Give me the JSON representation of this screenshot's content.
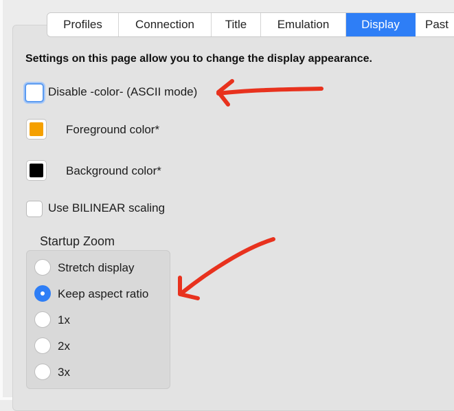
{
  "tabs": [
    {
      "label": "Profiles",
      "active": false
    },
    {
      "label": "Connection",
      "active": false
    },
    {
      "label": "Title",
      "active": false
    },
    {
      "label": "Emulation",
      "active": false
    },
    {
      "label": "Display",
      "active": true
    },
    {
      "label": "Past",
      "active": false
    }
  ],
  "display": {
    "description": "Settings on this page allow you to change the display appearance.",
    "disable_color": {
      "label": "Disable -color- (ASCII mode)",
      "checked": false
    },
    "foreground": {
      "label": "Foreground color*",
      "color": "#f5a000"
    },
    "background": {
      "label": "Background color*",
      "color": "#000000"
    },
    "bilinear": {
      "label": "Use BILINEAR scaling",
      "checked": false
    },
    "startup_zoom": {
      "title": "Startup Zoom",
      "options": [
        {
          "label": "Stretch display",
          "selected": false
        },
        {
          "label": "Keep aspect ratio",
          "selected": true
        },
        {
          "label": "1x",
          "selected": false
        },
        {
          "label": "2x",
          "selected": false
        },
        {
          "label": "3x",
          "selected": false
        }
      ]
    }
  },
  "annotation_color": "#e8321e"
}
